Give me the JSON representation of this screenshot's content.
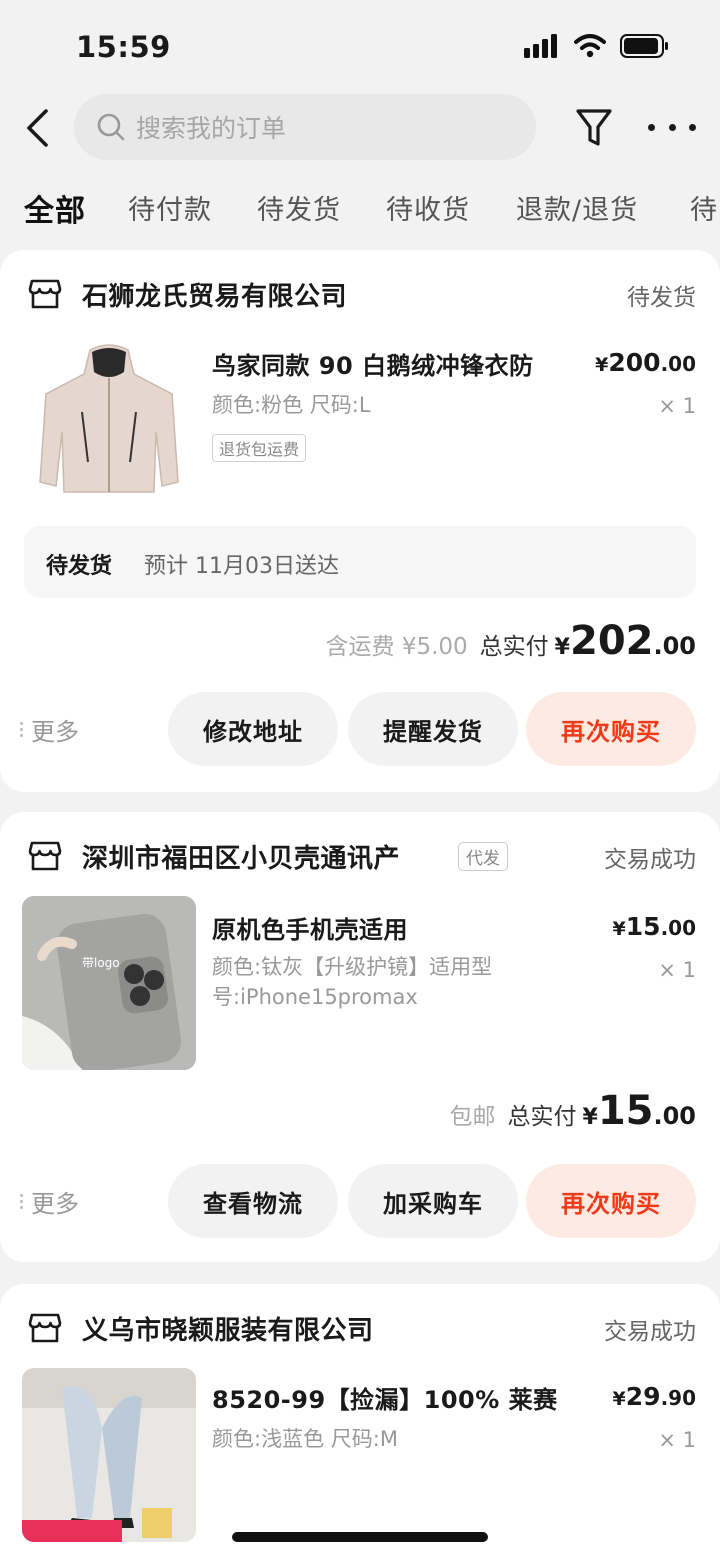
{
  "status_bar": {
    "time": "15:59"
  },
  "header": {
    "search_placeholder": "搜索我的订单"
  },
  "tabs": [
    "全部",
    "待付款",
    "待发货",
    "待收货",
    "退款/退货",
    "待"
  ],
  "orders": [
    {
      "shop": "石狮龙氏贸易有限公司",
      "status": "待发货",
      "product": {
        "title": "鸟家同款 90 白鹅绒冲锋衣防",
        "spec": "颜色:粉色 尺码:L",
        "tag": "退货包运费",
        "price_symbol": "¥",
        "price_int": "200",
        "price_dec": ".00",
        "qty": "× 1"
      },
      "shipping": {
        "status": "待发货",
        "eta": "预计 11月03日送达"
      },
      "total": {
        "note": "含运费 ¥5.00",
        "label": "总实付",
        "symbol": "¥",
        "int": "202",
        "dec": ".00"
      },
      "more": "更多",
      "actions": [
        "修改地址",
        "提醒发货",
        "再次购买"
      ]
    },
    {
      "shop": "深圳市福田区小贝壳通讯产",
      "shop_tag": "代发",
      "status": "交易成功",
      "product": {
        "title": "原机色手机壳适用",
        "spec": "颜色:钛灰【升级护镜】适用型号:iPhone15promax",
        "price_symbol": "¥",
        "price_int": "15",
        "price_dec": ".00",
        "qty": "× 1",
        "image_text": "带logo"
      },
      "total": {
        "note": "包邮",
        "label": "总实付",
        "symbol": "¥",
        "int": "15",
        "dec": ".00"
      },
      "more": "更多",
      "actions": [
        "查看物流",
        "加采购车",
        "再次购买"
      ]
    },
    {
      "shop": "义乌市晓颖服装有限公司",
      "status": "交易成功",
      "product": {
        "title": "8520-99【捡漏】100% 莱赛",
        "spec": "颜色:浅蓝色 尺码:M",
        "price_symbol": "¥",
        "price_int": "29",
        "price_dec": ".90",
        "qty": "× 1"
      }
    }
  ],
  "colors": {
    "accent": "#f03b1a",
    "accent_bg": "#fdeae3",
    "page_bg": "#f2f2f2"
  }
}
